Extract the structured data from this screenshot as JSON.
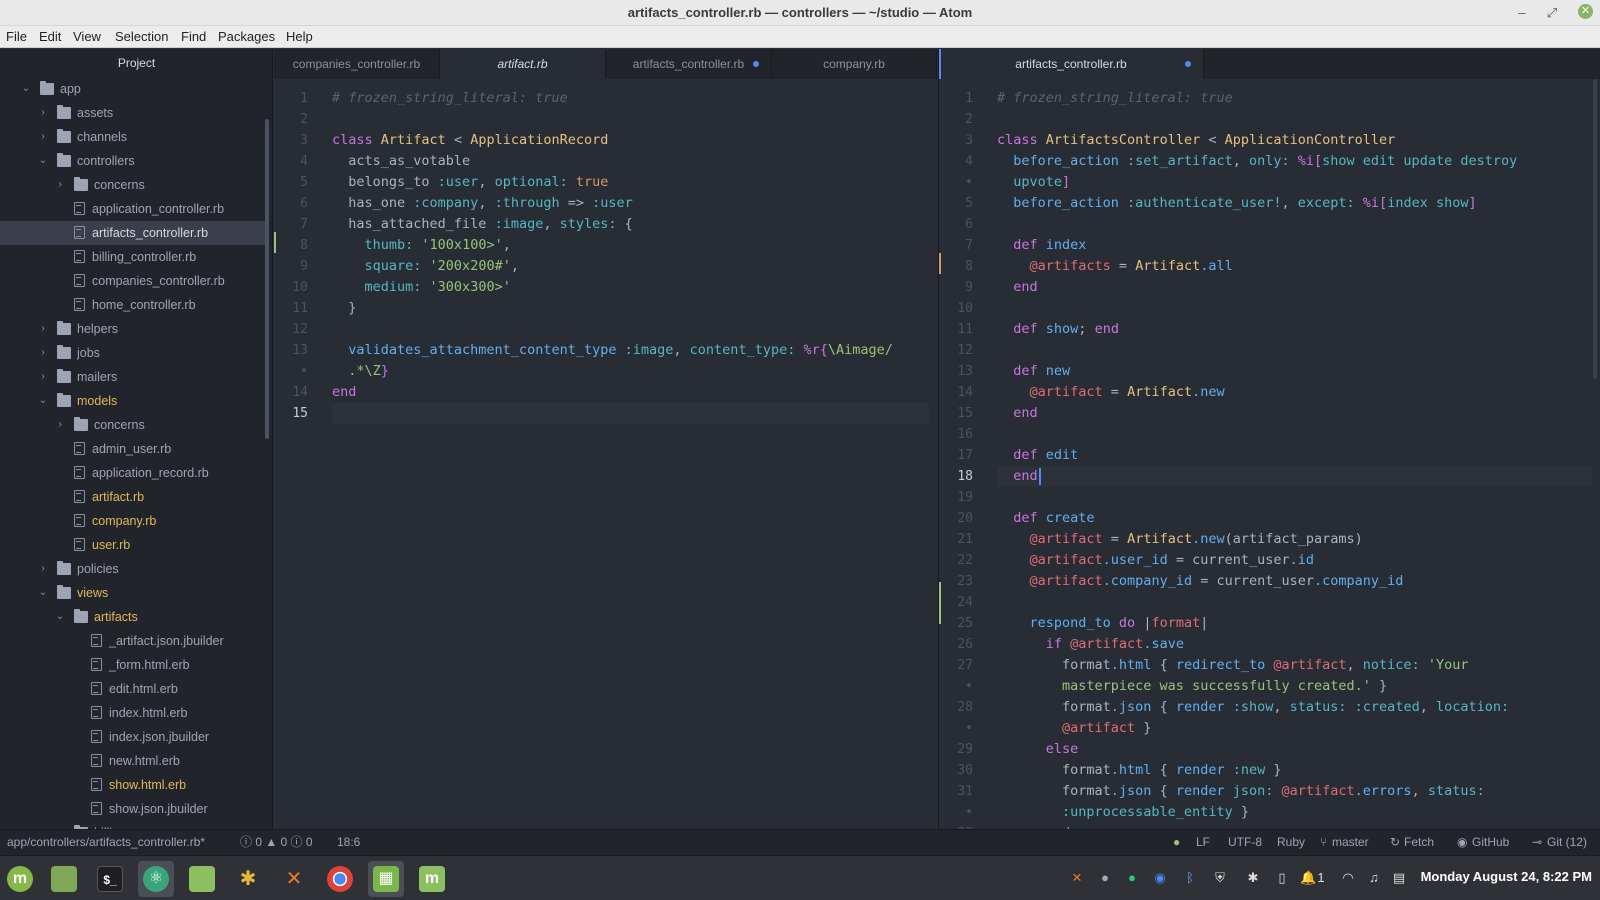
{
  "window": {
    "title": "artifacts_controller.rb — controllers — ~/studio — Atom"
  },
  "menu": [
    "File",
    "Edit",
    "View",
    "Selection",
    "Find",
    "Packages",
    "Help"
  ],
  "tree": {
    "header": "Project",
    "rows": [
      {
        "name": "app",
        "type": "folder",
        "depth": 0,
        "open": true
      },
      {
        "name": "assets",
        "type": "folder",
        "depth": 1,
        "open": false
      },
      {
        "name": "channels",
        "type": "folder",
        "depth": 1,
        "open": false
      },
      {
        "name": "controllers",
        "type": "folder",
        "depth": 1,
        "open": true
      },
      {
        "name": "concerns",
        "type": "folder",
        "depth": 2,
        "open": false
      },
      {
        "name": "application_controller.rb",
        "type": "file",
        "depth": 2
      },
      {
        "name": "artifacts_controller.rb",
        "type": "file",
        "depth": 2,
        "selected": true
      },
      {
        "name": "billing_controller.rb",
        "type": "file",
        "depth": 2
      },
      {
        "name": "companies_controller.rb",
        "type": "file",
        "depth": 2
      },
      {
        "name": "home_controller.rb",
        "type": "file",
        "depth": 2
      },
      {
        "name": "helpers",
        "type": "folder",
        "depth": 1,
        "open": false
      },
      {
        "name": "jobs",
        "type": "folder",
        "depth": 1,
        "open": false
      },
      {
        "name": "mailers",
        "type": "folder",
        "depth": 1,
        "open": false
      },
      {
        "name": "models",
        "type": "folder",
        "depth": 1,
        "open": true,
        "modified": true
      },
      {
        "name": "concerns",
        "type": "folder",
        "depth": 2,
        "open": false
      },
      {
        "name": "admin_user.rb",
        "type": "file",
        "depth": 2
      },
      {
        "name": "application_record.rb",
        "type": "file",
        "depth": 2
      },
      {
        "name": "artifact.rb",
        "type": "file",
        "depth": 2,
        "modified": true
      },
      {
        "name": "company.rb",
        "type": "file",
        "depth": 2,
        "modified": true
      },
      {
        "name": "user.rb",
        "type": "file",
        "depth": 2,
        "modified": true
      },
      {
        "name": "policies",
        "type": "folder",
        "depth": 1,
        "open": false
      },
      {
        "name": "views",
        "type": "folder",
        "depth": 1,
        "open": true,
        "modified": true
      },
      {
        "name": "artifacts",
        "type": "folder",
        "depth": 2,
        "open": true,
        "modified": true
      },
      {
        "name": "_artifact.json.jbuilder",
        "type": "file",
        "depth": 3
      },
      {
        "name": "_form.html.erb",
        "type": "file",
        "depth": 3
      },
      {
        "name": "edit.html.erb",
        "type": "file",
        "depth": 3
      },
      {
        "name": "index.html.erb",
        "type": "file",
        "depth": 3
      },
      {
        "name": "index.json.jbuilder",
        "type": "file",
        "depth": 3
      },
      {
        "name": "new.html.erb",
        "type": "file",
        "depth": 3
      },
      {
        "name": "show.html.erb",
        "type": "file",
        "depth": 3,
        "modified": true
      },
      {
        "name": "show.json.jbuilder",
        "type": "file",
        "depth": 3
      },
      {
        "name": "billing",
        "type": "folder",
        "depth": 2,
        "open": false
      }
    ]
  },
  "pane_left": {
    "tabs": [
      {
        "label": "companies_controller.rb",
        "active": false,
        "italic": false,
        "modified": false
      },
      {
        "label": "artifact.rb",
        "active": true,
        "italic": true,
        "modified": false
      },
      {
        "label": "artifacts_controller.rb",
        "active": false,
        "italic": false,
        "modified": true
      },
      {
        "label": "company.rb",
        "active": false,
        "italic": false,
        "modified": false
      }
    ],
    "lines": [
      {
        "n": "1",
        "t": [
          [
            "c-com",
            "# frozen_string_literal: true"
          ]
        ]
      },
      {
        "n": "2",
        "t": []
      },
      {
        "n": "3",
        "t": [
          [
            "c-kw",
            "class "
          ],
          [
            "c-cls",
            "Artifact"
          ],
          [
            "",
            " < "
          ],
          [
            "c-cls",
            "ApplicationRecord"
          ]
        ]
      },
      {
        "n": "4",
        "t": [
          [
            "",
            "  acts_as_votable"
          ]
        ]
      },
      {
        "n": "5",
        "t": [
          [
            "",
            "  belongs_to "
          ],
          [
            "c-sym",
            ":user"
          ],
          [
            "",
            ", "
          ],
          [
            "c-sym",
            "optional:"
          ],
          [
            "c-num",
            " true"
          ]
        ]
      },
      {
        "n": "6",
        "t": [
          [
            "",
            "  has_one "
          ],
          [
            "c-sym",
            ":company"
          ],
          [
            "",
            ", "
          ],
          [
            "c-sym",
            ":through"
          ],
          [
            "",
            " => "
          ],
          [
            "c-sym",
            ":user"
          ]
        ]
      },
      {
        "n": "7",
        "t": [
          [
            "",
            "  has_attached_file "
          ],
          [
            "c-sym",
            ":image"
          ],
          [
            "",
            ", "
          ],
          [
            "c-sym",
            "styles:"
          ],
          [
            "",
            " {"
          ]
        ]
      },
      {
        "n": "8",
        "t": [
          [
            "",
            "    "
          ],
          [
            "c-sym",
            "thumb:"
          ],
          [
            "c-str",
            " '100x100>'"
          ],
          [
            "",
            ","
          ]
        ]
      },
      {
        "n": "9",
        "t": [
          [
            "",
            "    "
          ],
          [
            "c-sym",
            "square:"
          ],
          [
            "c-str",
            " '200x200#'"
          ],
          [
            "",
            ","
          ]
        ]
      },
      {
        "n": "10",
        "t": [
          [
            "",
            "    "
          ],
          [
            "c-sym",
            "medium:"
          ],
          [
            "c-str",
            " '300x300>'"
          ]
        ]
      },
      {
        "n": "11",
        "t": [
          [
            "",
            "  }"
          ]
        ]
      },
      {
        "n": "12",
        "t": []
      },
      {
        "n": "13",
        "t": [
          [
            "c-fn",
            "  validates_attachment_content_type"
          ],
          [
            "",
            " "
          ],
          [
            "c-sym",
            ":image"
          ],
          [
            "",
            ", "
          ],
          [
            "c-sym",
            "content_type:"
          ],
          [
            "c-kw",
            " %r{"
          ],
          [
            "c-str",
            "\\Aimage/"
          ]
        ]
      },
      {
        "n": "•",
        "t": [
          [
            "c-str",
            "  .*\\Z"
          ],
          [
            "c-kw",
            "}"
          ]
        ]
      },
      {
        "n": "14",
        "t": [
          [
            "c-kw",
            "end"
          ]
        ]
      },
      {
        "n": "15",
        "t": [],
        "current": true
      }
    ]
  },
  "pane_right": {
    "tabs": [
      {
        "label": "artifacts_controller.rb",
        "active": true,
        "italic": false,
        "modified": true
      }
    ],
    "lines": [
      {
        "n": "1",
        "t": [
          [
            "c-com",
            "# frozen_string_literal: true"
          ]
        ]
      },
      {
        "n": "2",
        "t": []
      },
      {
        "n": "3",
        "t": [
          [
            "c-kw",
            "class "
          ],
          [
            "c-cls",
            "ArtifactsController"
          ],
          [
            "",
            " < "
          ],
          [
            "c-cls",
            "ApplicationController"
          ]
        ]
      },
      {
        "n": "4",
        "t": [
          [
            "c-fn",
            "  before_action "
          ],
          [
            "c-sym",
            ":set_artifact"
          ],
          [
            "",
            ", "
          ],
          [
            "c-sym",
            "only:"
          ],
          [
            "",
            " "
          ],
          [
            "c-kw",
            "%i["
          ],
          [
            "c-sym",
            "show edit update destroy"
          ]
        ]
      },
      {
        "n": "•",
        "t": [
          [
            "c-sym",
            "  upvote"
          ],
          [
            "c-kw",
            "]"
          ]
        ]
      },
      {
        "n": "5",
        "t": [
          [
            "c-fn",
            "  before_action "
          ],
          [
            "c-sym",
            ":authenticate_user!"
          ],
          [
            "",
            ", "
          ],
          [
            "c-sym",
            "except:"
          ],
          [
            "",
            " "
          ],
          [
            "c-kw",
            "%i["
          ],
          [
            "c-sym",
            "index show"
          ],
          [
            "c-kw",
            "]"
          ]
        ]
      },
      {
        "n": "6",
        "t": []
      },
      {
        "n": "7",
        "t": [
          [
            "c-kw",
            "  def "
          ],
          [
            "c-fn",
            "index"
          ]
        ]
      },
      {
        "n": "8",
        "t": [
          [
            "c-ivar",
            "    @artifacts"
          ],
          [
            "",
            " = "
          ],
          [
            "c-cls",
            "Artifact"
          ],
          [
            "c-fn",
            ".all"
          ]
        ]
      },
      {
        "n": "9",
        "t": [
          [
            "c-kw",
            "  end"
          ]
        ]
      },
      {
        "n": "10",
        "t": []
      },
      {
        "n": "11",
        "t": [
          [
            "c-kw",
            "  def "
          ],
          [
            "c-fn",
            "show"
          ],
          [
            "",
            ";"
          ],
          [
            "c-kw",
            " end"
          ]
        ]
      },
      {
        "n": "12",
        "t": []
      },
      {
        "n": "13",
        "t": [
          [
            "c-kw",
            "  def "
          ],
          [
            "c-fn",
            "new"
          ]
        ]
      },
      {
        "n": "14",
        "t": [
          [
            "c-ivar",
            "    @artifact"
          ],
          [
            "",
            " = "
          ],
          [
            "c-cls",
            "Artifact"
          ],
          [
            "c-fn",
            ".new"
          ]
        ]
      },
      {
        "n": "15",
        "t": [
          [
            "c-kw",
            "  end"
          ]
        ]
      },
      {
        "n": "16",
        "t": []
      },
      {
        "n": "17",
        "t": [
          [
            "c-kw",
            "  def "
          ],
          [
            "c-fn",
            "edit"
          ]
        ]
      },
      {
        "n": "18",
        "t": [
          [
            "c-kw",
            "  end"
          ]
        ],
        "current": true,
        "cursor": true
      },
      {
        "n": "19",
        "t": []
      },
      {
        "n": "20",
        "t": [
          [
            "c-kw",
            "  def "
          ],
          [
            "c-fn",
            "create"
          ]
        ]
      },
      {
        "n": "21",
        "t": [
          [
            "c-ivar",
            "    @artifact"
          ],
          [
            "",
            " = "
          ],
          [
            "c-cls",
            "Artifact"
          ],
          [
            "c-fn",
            ".new"
          ],
          [
            "",
            "(artifact_params)"
          ]
        ]
      },
      {
        "n": "22",
        "t": [
          [
            "c-ivar",
            "    @artifact"
          ],
          [
            "c-fn",
            ".user_id"
          ],
          [
            "",
            " = current_user"
          ],
          [
            "c-fn",
            ".id"
          ]
        ]
      },
      {
        "n": "23",
        "t": [
          [
            "c-ivar",
            "    @artifact"
          ],
          [
            "c-fn",
            ".company_id"
          ],
          [
            "",
            " = current_user"
          ],
          [
            "c-fn",
            ".company_id"
          ]
        ]
      },
      {
        "n": "24",
        "t": []
      },
      {
        "n": "25",
        "t": [
          [
            "c-fn",
            "    respond_to "
          ],
          [
            "c-kw",
            "do"
          ],
          [
            "",
            " |"
          ],
          [
            "c-ivar",
            "format"
          ],
          [
            "",
            "|"
          ]
        ]
      },
      {
        "n": "26",
        "t": [
          [
            "c-kw",
            "      if "
          ],
          [
            "c-ivar",
            "@artifact"
          ],
          [
            "c-fn",
            ".save"
          ]
        ]
      },
      {
        "n": "27",
        "t": [
          [
            "",
            "        format"
          ],
          [
            "c-fn",
            ".html"
          ],
          [
            "",
            " { "
          ],
          [
            "c-fn",
            "redirect_to "
          ],
          [
            "c-ivar",
            "@artifact"
          ],
          [
            "",
            ", "
          ],
          [
            "c-sym",
            "notice:"
          ],
          [
            "c-str",
            " 'Your"
          ]
        ]
      },
      {
        "n": "•",
        "t": [
          [
            "c-str",
            "        masterpiece was successfully created.'"
          ],
          [
            "",
            " }"
          ]
        ]
      },
      {
        "n": "28",
        "t": [
          [
            "",
            "        format"
          ],
          [
            "c-fn",
            ".json"
          ],
          [
            "",
            " { "
          ],
          [
            "c-fn",
            "render "
          ],
          [
            "c-sym",
            ":show"
          ],
          [
            "",
            ", "
          ],
          [
            "c-sym",
            "status:"
          ],
          [
            "c-sym",
            " :created"
          ],
          [
            "",
            ", "
          ],
          [
            "c-sym",
            "location:"
          ]
        ]
      },
      {
        "n": "•",
        "t": [
          [
            "c-ivar",
            "        @artifact"
          ],
          [
            "",
            " }"
          ]
        ]
      },
      {
        "n": "29",
        "t": [
          [
            "c-kw",
            "      else"
          ]
        ]
      },
      {
        "n": "30",
        "t": [
          [
            "",
            "        format"
          ],
          [
            "c-fn",
            ".html"
          ],
          [
            "",
            " { "
          ],
          [
            "c-fn",
            "render "
          ],
          [
            "c-sym",
            ":new"
          ],
          [
            "",
            " }"
          ]
        ]
      },
      {
        "n": "31",
        "t": [
          [
            "",
            "        format"
          ],
          [
            "c-fn",
            ".json"
          ],
          [
            "",
            " { "
          ],
          [
            "c-fn",
            "render "
          ],
          [
            "c-sym",
            "json:"
          ],
          [
            "c-ivar",
            " @artifact"
          ],
          [
            "c-fn",
            ".errors"
          ],
          [
            "",
            ", "
          ],
          [
            "c-sym",
            "status:"
          ]
        ]
      },
      {
        "n": "•",
        "t": [
          [
            "c-sym",
            "        :unprocessable_entity"
          ],
          [
            "",
            " }"
          ]
        ]
      },
      {
        "n": "32",
        "t": [
          [
            "c-kw",
            "      end"
          ]
        ]
      }
    ]
  },
  "status": {
    "path": "app/controllers/artifacts_controller.rb*",
    "diagnostics": "ⓘ 0 ▲ 0 ⓘ 0",
    "cursor_pos": "18:6",
    "line_ending": "LF",
    "encoding": "UTF-8",
    "grammar": "Ruby",
    "branch": "master",
    "fetch": "Fetch",
    "github": "GitHub",
    "git": "Git (12)"
  },
  "taskbar": {
    "clock": "Monday August 24, 8:22 PM",
    "notification_count": "1"
  }
}
